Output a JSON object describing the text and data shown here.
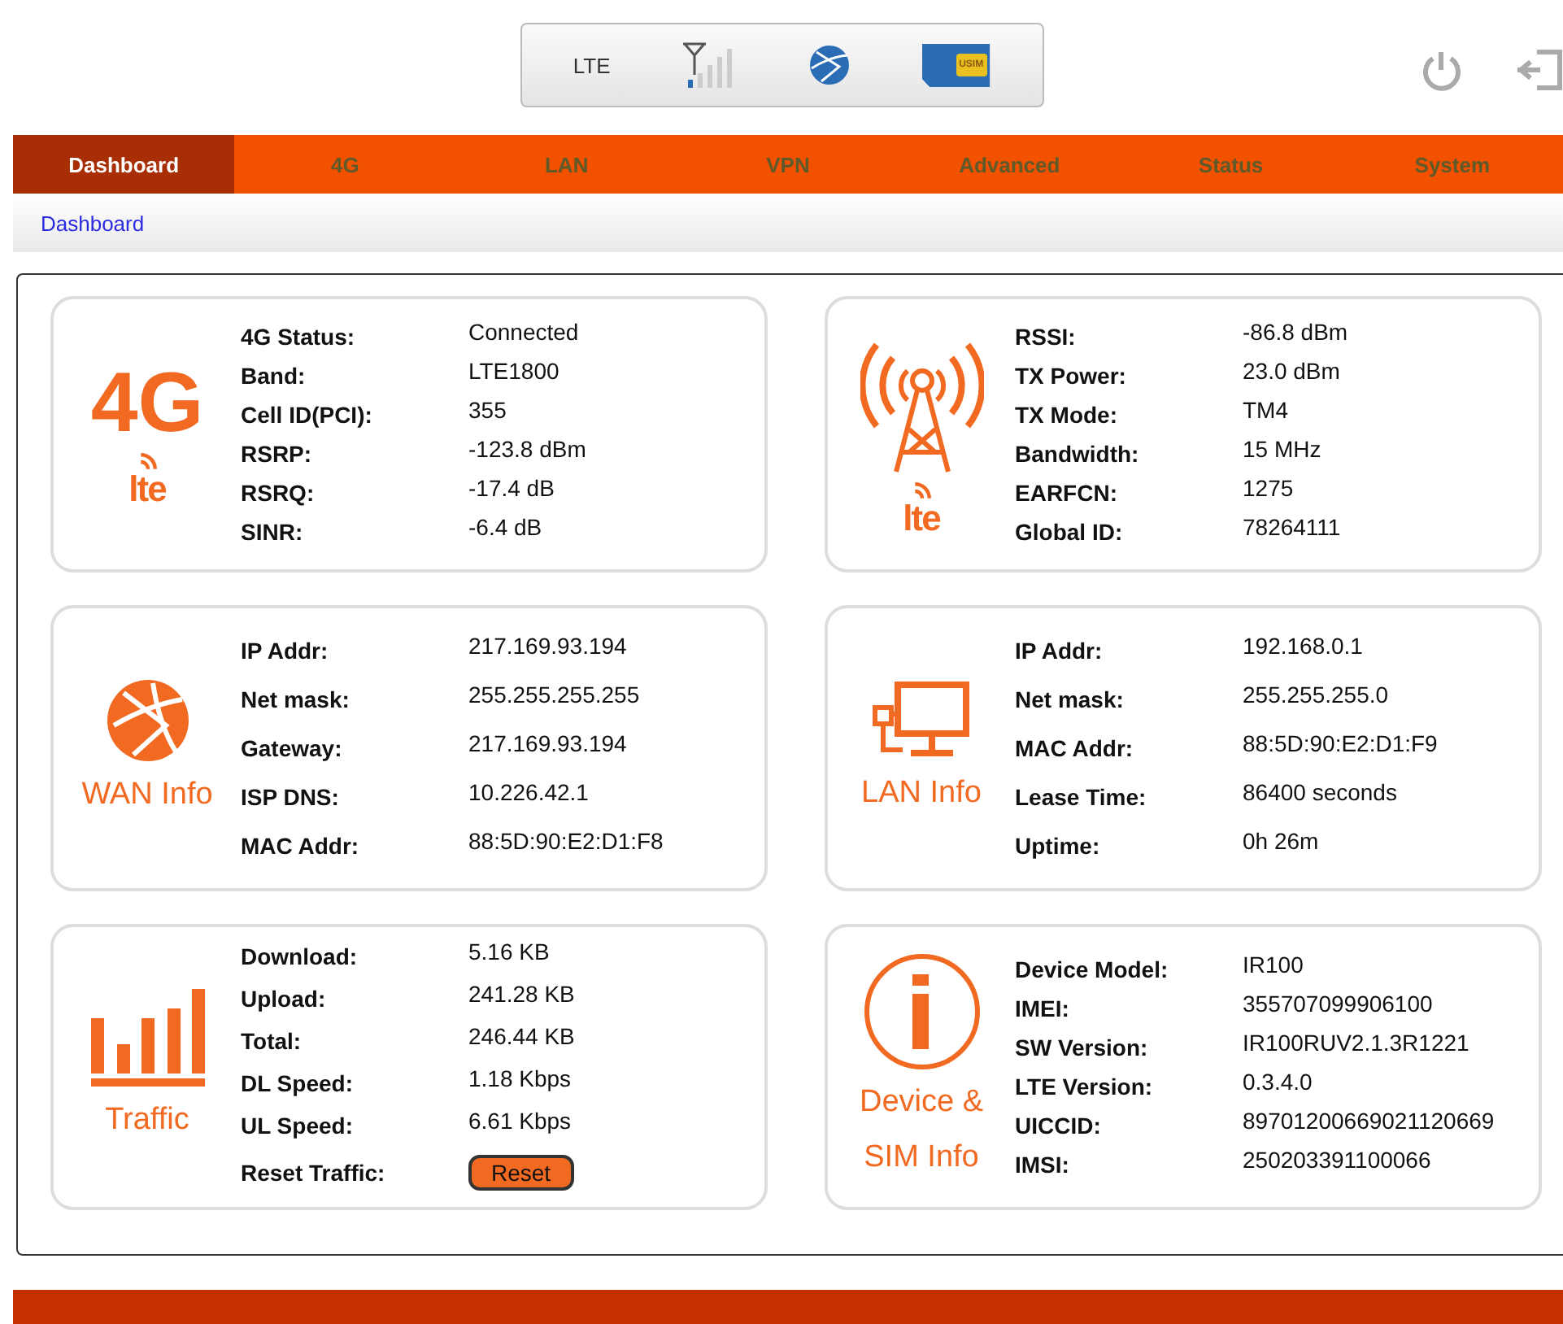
{
  "status_bar": {
    "network": "LTE",
    "sim_label": "USIM"
  },
  "tabs": [
    {
      "label": "Dashboard",
      "selected": true
    },
    {
      "label": "4G",
      "selected": false
    },
    {
      "label": "LAN",
      "selected": false
    },
    {
      "label": "VPN",
      "selected": false
    },
    {
      "label": "Advanced",
      "selected": false
    },
    {
      "label": "Status",
      "selected": false
    },
    {
      "label": "System",
      "selected": false
    }
  ],
  "breadcrumb": "Dashboard",
  "cards": [
    {
      "kind": "badge",
      "badge": "4G",
      "logo": "lte",
      "rows": [
        {
          "label": "4G Status:",
          "value": "Connected"
        },
        {
          "label": "Band:",
          "value": "LTE1800"
        },
        {
          "label": "Cell ID(PCI):",
          "value": "355"
        },
        {
          "label": "RSRP:",
          "value": "-123.8 dBm"
        },
        {
          "label": "RSRQ:",
          "value": "-17.4 dB"
        },
        {
          "label": "SINR:",
          "value": "-6.4 dB"
        }
      ]
    },
    {
      "kind": "tower",
      "logo": "lte",
      "rows": [
        {
          "label": "RSSI:",
          "value": "-86.8  dBm"
        },
        {
          "label": "TX Power:",
          "value": "23.0 dBm"
        },
        {
          "label": "TX Mode:",
          "value": "TM4"
        },
        {
          "label": "Bandwidth:",
          "value": "15 MHz"
        },
        {
          "label": "EARFCN:",
          "value": "1275"
        },
        {
          "label": "Global ID:",
          "value": "78264111"
        }
      ]
    },
    {
      "kind": "wan",
      "caption": [
        "WAN Info"
      ],
      "rows": [
        {
          "label": "IP Addr:",
          "value": "217.169.93.194"
        },
        {
          "label": "Net mask:",
          "value": "255.255.255.255"
        },
        {
          "label": "Gateway:",
          "value": "217.169.93.194"
        },
        {
          "label": "ISP DNS:",
          "value": "10.226.42.1"
        },
        {
          "label": "MAC Addr:",
          "value": "88:5D:90:E2:D1:F8"
        }
      ]
    },
    {
      "kind": "lan",
      "caption": [
        "LAN Info"
      ],
      "rows": [
        {
          "label": "IP Addr:",
          "value": "192.168.0.1"
        },
        {
          "label": "Net mask:",
          "value": "255.255.255.0"
        },
        {
          "label": "MAC Addr:",
          "value": "88:5D:90:E2:D1:F9"
        },
        {
          "label": "Lease Time:",
          "value": "86400 seconds"
        },
        {
          "label": "Uptime:",
          "value": "0h 26m"
        }
      ]
    },
    {
      "kind": "traffic",
      "caption": [
        "Traffic"
      ],
      "rows": [
        {
          "label": "Download:",
          "value": "5.16 KB"
        },
        {
          "label": "Upload:",
          "value": "241.28 KB"
        },
        {
          "label": "Total:",
          "value": "246.44 KB"
        },
        {
          "label": "DL Speed:",
          "value": "1.18 Kbps"
        },
        {
          "label": "UL Speed:",
          "value": "6.61 Kbps"
        },
        {
          "label": "Reset Traffic:",
          "button": "Reset"
        }
      ]
    },
    {
      "kind": "info",
      "caption": [
        "Device &",
        "SIM Info"
      ],
      "rows": [
        {
          "label": "Device Model:",
          "value": "IR100"
        },
        {
          "label": "IMEI:",
          "value": "355707099906100"
        },
        {
          "label": "SW Version:",
          "value": "IR100RUV2.1.3R1221"
        },
        {
          "label": "LTE Version:",
          "value": "0.3.4.0"
        },
        {
          "label": "UICCID:",
          "value": "89701200669021120669"
        },
        {
          "label": "IMSI:",
          "value": "250203391100066"
        }
      ]
    }
  ]
}
